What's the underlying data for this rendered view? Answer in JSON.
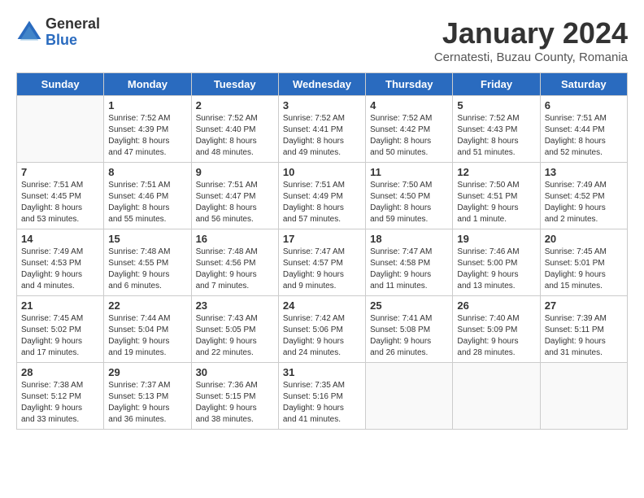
{
  "logo": {
    "general": "General",
    "blue": "Blue"
  },
  "title": "January 2024",
  "subtitle": "Cernatesti, Buzau County, Romania",
  "days_of_week": [
    "Sunday",
    "Monday",
    "Tuesday",
    "Wednesday",
    "Thursday",
    "Friday",
    "Saturday"
  ],
  "weeks": [
    [
      {
        "day": "",
        "info": ""
      },
      {
        "day": "1",
        "info": "Sunrise: 7:52 AM\nSunset: 4:39 PM\nDaylight: 8 hours\nand 47 minutes."
      },
      {
        "day": "2",
        "info": "Sunrise: 7:52 AM\nSunset: 4:40 PM\nDaylight: 8 hours\nand 48 minutes."
      },
      {
        "day": "3",
        "info": "Sunrise: 7:52 AM\nSunset: 4:41 PM\nDaylight: 8 hours\nand 49 minutes."
      },
      {
        "day": "4",
        "info": "Sunrise: 7:52 AM\nSunset: 4:42 PM\nDaylight: 8 hours\nand 50 minutes."
      },
      {
        "day": "5",
        "info": "Sunrise: 7:52 AM\nSunset: 4:43 PM\nDaylight: 8 hours\nand 51 minutes."
      },
      {
        "day": "6",
        "info": "Sunrise: 7:51 AM\nSunset: 4:44 PM\nDaylight: 8 hours\nand 52 minutes."
      }
    ],
    [
      {
        "day": "7",
        "info": "Sunrise: 7:51 AM\nSunset: 4:45 PM\nDaylight: 8 hours\nand 53 minutes."
      },
      {
        "day": "8",
        "info": "Sunrise: 7:51 AM\nSunset: 4:46 PM\nDaylight: 8 hours\nand 55 minutes."
      },
      {
        "day": "9",
        "info": "Sunrise: 7:51 AM\nSunset: 4:47 PM\nDaylight: 8 hours\nand 56 minutes."
      },
      {
        "day": "10",
        "info": "Sunrise: 7:51 AM\nSunset: 4:49 PM\nDaylight: 8 hours\nand 57 minutes."
      },
      {
        "day": "11",
        "info": "Sunrise: 7:50 AM\nSunset: 4:50 PM\nDaylight: 8 hours\nand 59 minutes."
      },
      {
        "day": "12",
        "info": "Sunrise: 7:50 AM\nSunset: 4:51 PM\nDaylight: 9 hours\nand 1 minute."
      },
      {
        "day": "13",
        "info": "Sunrise: 7:49 AM\nSunset: 4:52 PM\nDaylight: 9 hours\nand 2 minutes."
      }
    ],
    [
      {
        "day": "14",
        "info": "Sunrise: 7:49 AM\nSunset: 4:53 PM\nDaylight: 9 hours\nand 4 minutes."
      },
      {
        "day": "15",
        "info": "Sunrise: 7:48 AM\nSunset: 4:55 PM\nDaylight: 9 hours\nand 6 minutes."
      },
      {
        "day": "16",
        "info": "Sunrise: 7:48 AM\nSunset: 4:56 PM\nDaylight: 9 hours\nand 7 minutes."
      },
      {
        "day": "17",
        "info": "Sunrise: 7:47 AM\nSunset: 4:57 PM\nDaylight: 9 hours\nand 9 minutes."
      },
      {
        "day": "18",
        "info": "Sunrise: 7:47 AM\nSunset: 4:58 PM\nDaylight: 9 hours\nand 11 minutes."
      },
      {
        "day": "19",
        "info": "Sunrise: 7:46 AM\nSunset: 5:00 PM\nDaylight: 9 hours\nand 13 minutes."
      },
      {
        "day": "20",
        "info": "Sunrise: 7:45 AM\nSunset: 5:01 PM\nDaylight: 9 hours\nand 15 minutes."
      }
    ],
    [
      {
        "day": "21",
        "info": "Sunrise: 7:45 AM\nSunset: 5:02 PM\nDaylight: 9 hours\nand 17 minutes."
      },
      {
        "day": "22",
        "info": "Sunrise: 7:44 AM\nSunset: 5:04 PM\nDaylight: 9 hours\nand 19 minutes."
      },
      {
        "day": "23",
        "info": "Sunrise: 7:43 AM\nSunset: 5:05 PM\nDaylight: 9 hours\nand 22 minutes."
      },
      {
        "day": "24",
        "info": "Sunrise: 7:42 AM\nSunset: 5:06 PM\nDaylight: 9 hours\nand 24 minutes."
      },
      {
        "day": "25",
        "info": "Sunrise: 7:41 AM\nSunset: 5:08 PM\nDaylight: 9 hours\nand 26 minutes."
      },
      {
        "day": "26",
        "info": "Sunrise: 7:40 AM\nSunset: 5:09 PM\nDaylight: 9 hours\nand 28 minutes."
      },
      {
        "day": "27",
        "info": "Sunrise: 7:39 AM\nSunset: 5:11 PM\nDaylight: 9 hours\nand 31 minutes."
      }
    ],
    [
      {
        "day": "28",
        "info": "Sunrise: 7:38 AM\nSunset: 5:12 PM\nDaylight: 9 hours\nand 33 minutes."
      },
      {
        "day": "29",
        "info": "Sunrise: 7:37 AM\nSunset: 5:13 PM\nDaylight: 9 hours\nand 36 minutes."
      },
      {
        "day": "30",
        "info": "Sunrise: 7:36 AM\nSunset: 5:15 PM\nDaylight: 9 hours\nand 38 minutes."
      },
      {
        "day": "31",
        "info": "Sunrise: 7:35 AM\nSunset: 5:16 PM\nDaylight: 9 hours\nand 41 minutes."
      },
      {
        "day": "",
        "info": ""
      },
      {
        "day": "",
        "info": ""
      },
      {
        "day": "",
        "info": ""
      }
    ]
  ]
}
